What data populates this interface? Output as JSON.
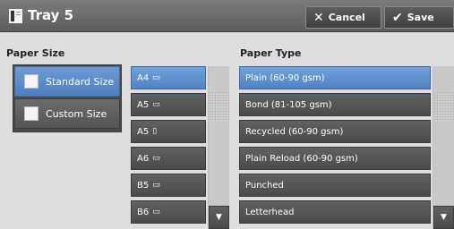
{
  "header": {
    "title": "Tray 5",
    "tray_icon": "tray-icon",
    "cancel_label": "Cancel",
    "cancel_icon": "✕",
    "save_label": "Save",
    "save_icon": "✔"
  },
  "paper_size": {
    "label": "Paper Size",
    "standard_label": "Standard Size",
    "custom_label": "Custom Size",
    "selected": "Standard Size",
    "sizes": [
      {
        "label": "A4",
        "orientation": "landscape",
        "glyph": "▭",
        "selected": true
      },
      {
        "label": "A5",
        "orientation": "landscape",
        "glyph": "▭",
        "selected": false
      },
      {
        "label": "A5",
        "orientation": "portrait",
        "glyph": "▯",
        "selected": false
      },
      {
        "label": "A6",
        "orientation": "landscape",
        "glyph": "▭",
        "selected": false
      },
      {
        "label": "B5",
        "orientation": "landscape",
        "glyph": "▭",
        "selected": false
      },
      {
        "label": "B6",
        "orientation": "landscape",
        "glyph": "▭",
        "selected": false
      }
    ]
  },
  "paper_type": {
    "label": "Paper Type",
    "types": [
      {
        "label": "Plain (60-90 gsm)",
        "selected": true
      },
      {
        "label": "Bond (81-105 gsm)",
        "selected": false
      },
      {
        "label": "Recycled (60-90 gsm)",
        "selected": false
      },
      {
        "label": "Plain Reload (60-90 gsm)",
        "selected": false
      },
      {
        "label": "Punched",
        "selected": false
      },
      {
        "label": "Letterhead",
        "selected": false
      }
    ]
  },
  "scroll": {
    "down_glyph": "▼"
  },
  "colors": {
    "selected": "#5a8ccc",
    "item": "#565656",
    "header": "#6a6a6a",
    "background": "#dedede"
  }
}
